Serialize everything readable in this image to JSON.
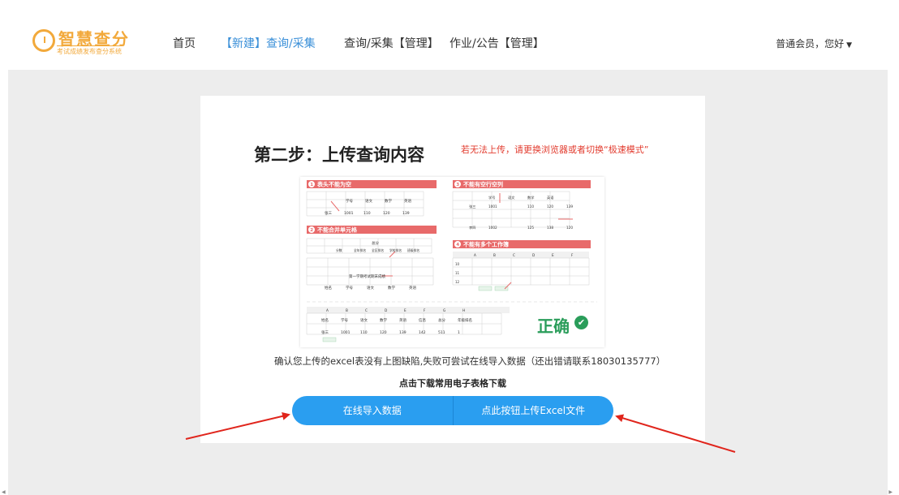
{
  "logo": {
    "title": "智慧查分",
    "subtitle": "考试成绩发布查分系统"
  },
  "nav": [
    {
      "label": "首页"
    },
    {
      "label": "【新建】查询/采集"
    },
    {
      "label": "查询/采集【管理】"
    },
    {
      "label": "作业/公告【管理】"
    }
  ],
  "user": {
    "label": "普通会员，您好"
  },
  "main": {
    "title": "第二步：上传查询内容",
    "warning": "若无法上传，请更换浏览器或者切换“极速模式”",
    "note": "确认您上传的excel表没有上图缺陷,失败可尝试在线导入数据（还出错请联系18030135777）",
    "download": "点击下载常用电子表格下载",
    "buttons": [
      {
        "label": "在线导入数据"
      },
      {
        "label": "点此按钮上传Excel文件"
      }
    ]
  },
  "guide": {
    "sections": [
      {
        "num": "1",
        "title": "表头不能为空"
      },
      {
        "num": "2",
        "title": "不能合并单元格"
      },
      {
        "num": "3",
        "title": "不能有空行空列"
      },
      {
        "num": "4",
        "title": "不能有多个工作簿"
      }
    ],
    "table1": {
      "headers": [
        "学号",
        "语文",
        "数学",
        "英语"
      ],
      "row": [
        "张三",
        "1001",
        "110",
        "120",
        "139"
      ]
    },
    "table2": {
      "merged": "总分",
      "subheads": [
        "分数",
        "全年排名",
        "全区排名",
        "学校排名",
        "班级排名"
      ],
      "caption": "第一学期考试期末成绩",
      "headers": [
        "姓名",
        "学号",
        "语文",
        "数学",
        "英语"
      ]
    },
    "table3": {
      "headers": [
        "学号",
        "语文",
        "数学",
        "英语"
      ],
      "rows": [
        [
          "张三",
          "1001",
          "110",
          "120",
          "139"
        ],
        [
          "李四",
          "1002",
          "125",
          "138",
          "120"
        ]
      ]
    },
    "table4": {
      "cols": [
        "A",
        "B",
        "C",
        "D",
        "E",
        "F"
      ],
      "rows": [
        "10",
        "11",
        "12"
      ]
    },
    "correct": {
      "cols": [
        "A",
        "B",
        "C",
        "D",
        "E",
        "F",
        "G",
        "H"
      ],
      "headers": [
        "姓名",
        "学号",
        "语文",
        "数学",
        "英语",
        "信息",
        "总分",
        "年级排名"
      ],
      "row": [
        "张三",
        "1001",
        "110",
        "120",
        "139",
        "142",
        "511",
        "1"
      ],
      "label": "正确",
      "icon": "check-circle-icon"
    }
  },
  "colors": {
    "accent": "#2a9ef0",
    "warning": "#e23b2e",
    "section": "#e86a6a",
    "correct": "#2a9d5a",
    "logo": "#f2a93b"
  }
}
